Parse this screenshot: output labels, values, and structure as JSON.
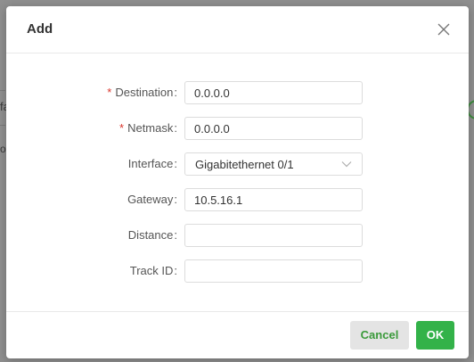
{
  "dialog": {
    "title": "Add",
    "close_icon": "close-icon"
  },
  "background": {
    "fragment_a": "fa",
    "fragment_b": "o"
  },
  "form": {
    "destination": {
      "label": "Destination",
      "required_mark": "*",
      "value": "0.0.0.0"
    },
    "netmask": {
      "label": "Netmask",
      "required_mark": "*",
      "value": "0.0.0.0"
    },
    "interface": {
      "label": "Interface",
      "value": "Gigabitethernet 0/1",
      "icon": "chevron-down-icon"
    },
    "gateway": {
      "label": "Gateway",
      "value": "10.5.16.1"
    },
    "distance": {
      "label": "Distance",
      "value": ""
    },
    "track_id": {
      "label": "Track ID",
      "value": ""
    },
    "colon": ":"
  },
  "footer": {
    "cancel_label": "Cancel",
    "ok_label": "OK"
  },
  "colors": {
    "accent_green": "#33b249",
    "required_red": "#d9342b",
    "cancel_bg": "#e4e4e4"
  }
}
